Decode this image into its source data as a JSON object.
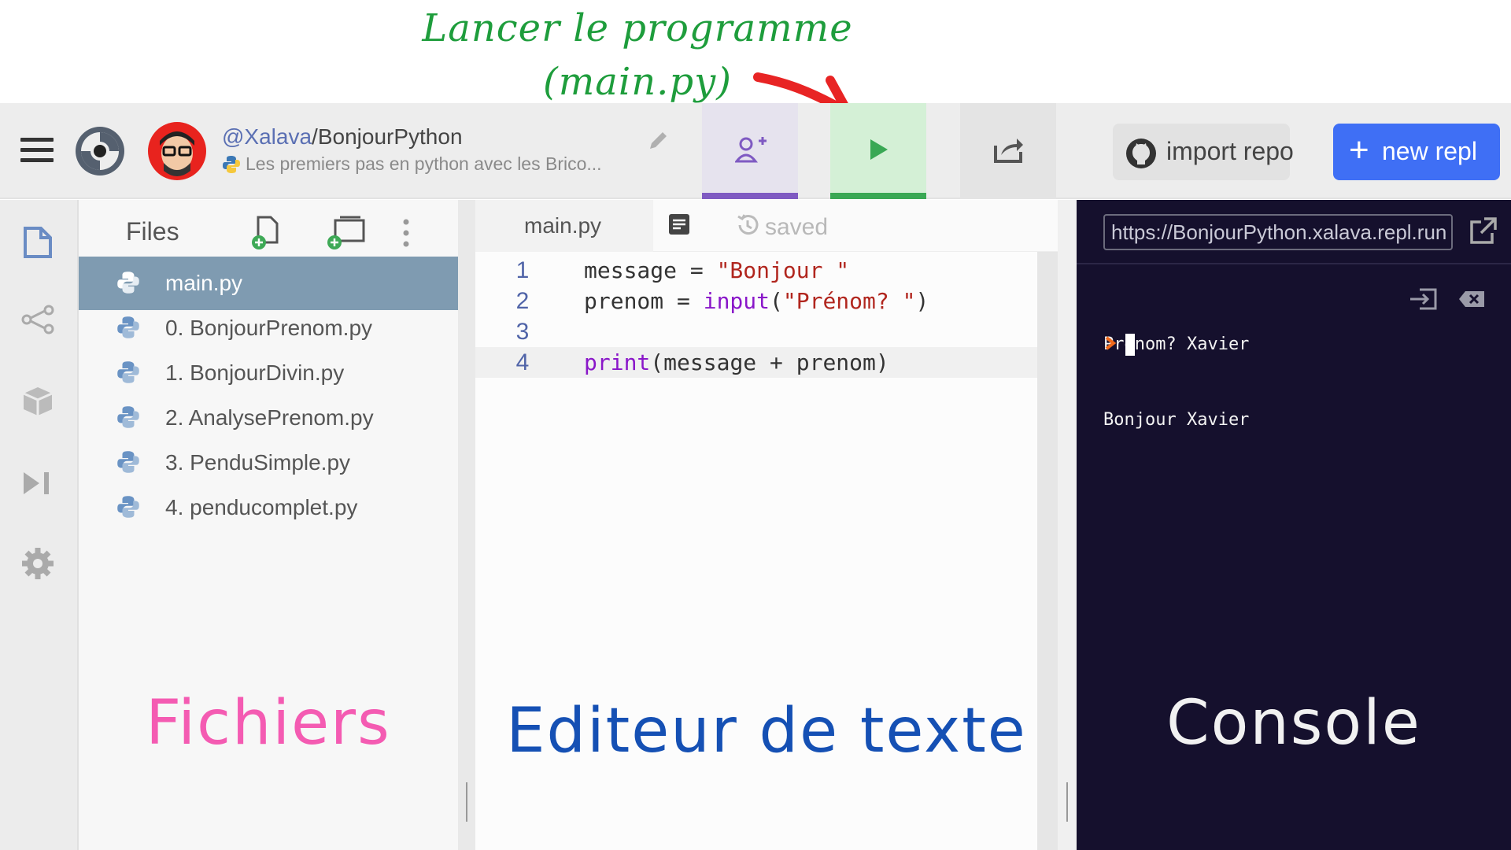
{
  "annotations": {
    "run_note": "Lancer le programme\n(main.py)",
    "files_note": "Fichiers",
    "editor_note": "Editeur de texte",
    "console_note": "Console",
    "colors": {
      "run": "#1e9d3c",
      "files": "#f45bb2",
      "editor": "#1550b4",
      "console": "#f1f1f1",
      "arrow": "#e82424"
    }
  },
  "header": {
    "owner": "@Xalava",
    "separator": "/",
    "repl_name": "BonjourPython",
    "description": "Les premiers pas en python avec les Brico...",
    "icons": [
      "menu-icon",
      "replit-logo-icon",
      "avatar",
      "pencil-icon",
      "invite-user-icon",
      "run-play-icon",
      "share-icon",
      "github-icon"
    ],
    "import_label": "import repo",
    "new_label": "new repl",
    "new_plus": "+"
  },
  "files": {
    "title": "Files",
    "items": [
      {
        "name": "main.py",
        "active": true
      },
      {
        "name": "0. BonjourPrenom.py"
      },
      {
        "name": "1. BonjourDivin.py"
      },
      {
        "name": "2. AnalysePrenom.py"
      },
      {
        "name": "3. PenduSimple.py"
      },
      {
        "name": "4. penducomplet.py"
      }
    ]
  },
  "editor": {
    "tab": "main.py",
    "status": "saved",
    "lines": [
      {
        "n": "1",
        "parts": [
          {
            "t": "message = ",
            "c": ""
          },
          {
            "t": "\"Bonjour \"",
            "c": "str"
          }
        ]
      },
      {
        "n": "2",
        "parts": [
          {
            "t": "prenom = ",
            "c": ""
          },
          {
            "t": "input",
            "c": "fn"
          },
          {
            "t": "(",
            "c": ""
          },
          {
            "t": "\"Prénom? \"",
            "c": "str"
          },
          {
            "t": ")",
            "c": ""
          }
        ]
      },
      {
        "n": "3",
        "parts": []
      },
      {
        "n": "4",
        "parts": [
          {
            "t": "print",
            "c": "fn"
          },
          {
            "t": "(message + prenom)",
            "c": ""
          }
        ]
      }
    ]
  },
  "console": {
    "url": "https://BonjourPython.xalava.repl.run",
    "output": [
      "Prénom? Xavier",
      "Bonjour Xavier"
    ],
    "prompt": ">"
  }
}
